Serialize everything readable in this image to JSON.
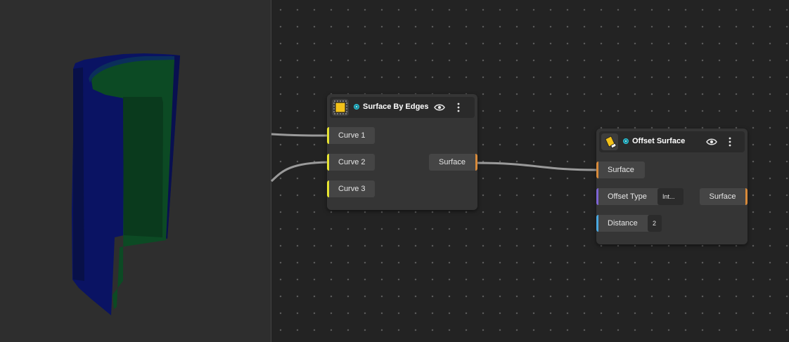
{
  "viewport": {
    "colors": {
      "background": "#2e2e2e",
      "outer_face": "#0a1363",
      "inner_face": "#0c4a24"
    }
  },
  "canvas": {
    "background": "#232323",
    "wire_color": "#9a9a9a"
  },
  "nodes": {
    "surface_by_edges": {
      "title": "Surface By Edges",
      "icon": "surface-square-icon",
      "inputs": [
        "Curve 1",
        "Curve 2",
        "Curve 3"
      ],
      "output": "Surface"
    },
    "offset_surface": {
      "title": "Offset Surface",
      "icon": "offset-surface-icon",
      "inputs": [
        {
          "label": "Surface",
          "value": ""
        },
        {
          "label": "Offset Type",
          "value": "Int..."
        },
        {
          "label": "Distance",
          "value": "2"
        }
      ],
      "output": "Surface"
    }
  },
  "colors": {
    "curve_port": "#e7e432",
    "surface_port": "#d88a3a",
    "enum_port": "#7d64d4",
    "number_port": "#4aa8e0",
    "status": "#2fc6d8"
  }
}
